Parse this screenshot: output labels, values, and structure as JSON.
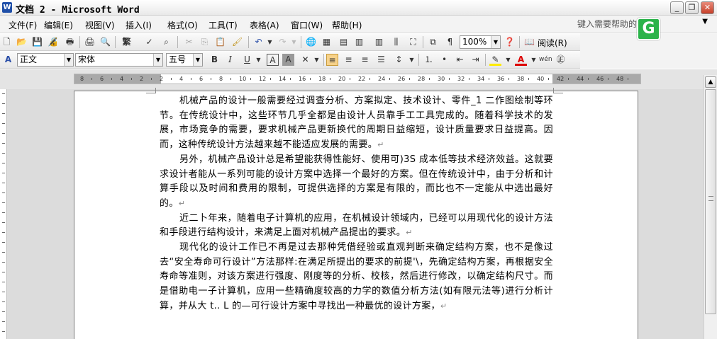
{
  "window": {
    "app_icon_letter": "W",
    "title": "文档 2 - Microsoft Word",
    "buttons": [
      "_",
      "❐",
      "✕"
    ]
  },
  "menu": {
    "items": [
      "文件(F)",
      "编辑(E)",
      "视图(V)",
      "插入(I)",
      "格式(O)",
      "工具(T)",
      "表格(A)",
      "窗口(W)",
      "帮助(H)"
    ],
    "help_placeholder": "键入需要帮助的"
  },
  "toolbar_standard": {
    "zoom": "100%",
    "read_label": "阅读(R)"
  },
  "toolbar_formatting": {
    "style": "正文",
    "font": "宋体",
    "size": "五号",
    "bold": "B",
    "italic": "I",
    "underline": "U",
    "char_border": "A",
    "char_shading": "A"
  },
  "ruler": {
    "labels": [
      "8",
      "6",
      "4",
      "2",
      "2",
      "4",
      "6",
      "8",
      "10",
      "12",
      "14",
      "16",
      "18",
      "20",
      "22",
      "24",
      "26",
      "28",
      "30",
      "32",
      "34",
      "36",
      "38",
      "40",
      "42",
      "44",
      "46",
      "48"
    ]
  },
  "document": {
    "paragraphs": [
      "机械产品的设计一般需要经过调查分析、方案拟定、技术设计、零件_1 二作图绘制等环节。在传统设计中，这些环节几乎全都是由设计人员靠手工工具完成的。随着科学技术的发展，市场竟争的需要，要求机械产品更新换代的周期日益缩短，设计质量要求日益提高。因而，这种传统设计方法越来越不能适应发展的需要。",
      "另外，机械产品设计总是希望能获得性能好、使用可)3S 成本低等技术经济效益。这就要求设计者能从一系列可能的设计方案中选择一个最好的方案。但在传统设计中，由于分析和计算手段以及时间和费用的限制，可提供选择的方案是有限的，而比也不一定能从中选出最好的。",
      "近二卜年来，随着电子计算机的应用，在机械设计领域内，已经可以用现代化的设计方法和手段进行结构设计，来满足上面对机械产品提出的要求。",
      "现代化的设计工作已不再是过去那种凭借经验或直观判断来确定结构方案，也不是像过去“安全寿命可行设计”方法那样:在满足所提出的要求的前提'\\，先确定结构方案，再根据安全寿命等准则，对该方案进行强度、刚度等的分析、校核，然后进行修改，以确定结构尺寸。而是借助电一子计算机，应用一些精确度较高的力学的数值分析方法(如有限元法等)进行分析计算，并从大 t.. L 的—可行设计方案中寻找出一种最优的设计方案，"
    ],
    "para_mark": "↵"
  },
  "badge": {
    "letter": "G"
  }
}
